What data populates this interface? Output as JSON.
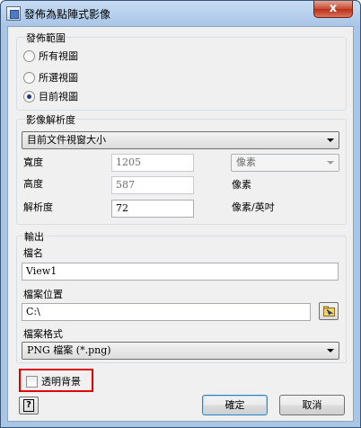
{
  "window": {
    "title": "發佈為點陣式影像",
    "close_label": "x"
  },
  "publish_range": {
    "label": "發佈範圍",
    "options": [
      {
        "label": "所有視圖",
        "selected": false
      },
      {
        "label": "所選視圖",
        "selected": false
      },
      {
        "label": "目前視圖",
        "selected": true
      }
    ]
  },
  "resolution": {
    "label": "影像解析度",
    "preset": "目前文件視窗大小",
    "width_label": "寬度",
    "width_value": "1205",
    "height_label": "高度",
    "height_value": "587",
    "dpi_label": "解析度",
    "dpi_value": "72",
    "unit_select": "像素",
    "height_unit": "像素",
    "dpi_unit": "像素/英吋"
  },
  "output": {
    "label": "輸出",
    "filename_label": "檔名",
    "filename_value": "View1",
    "location_label": "檔案位置",
    "location_value": "C:\\",
    "format_label": "檔案格式",
    "format_value": "PNG 檔案 (*.png)"
  },
  "transparent_bg": {
    "label": "透明背景",
    "checked": false
  },
  "buttons": {
    "help": "?",
    "ok": "確定",
    "cancel": "取消"
  },
  "colors": {
    "highlight_border": "#e00000",
    "title_bar": "#aac6e6"
  }
}
